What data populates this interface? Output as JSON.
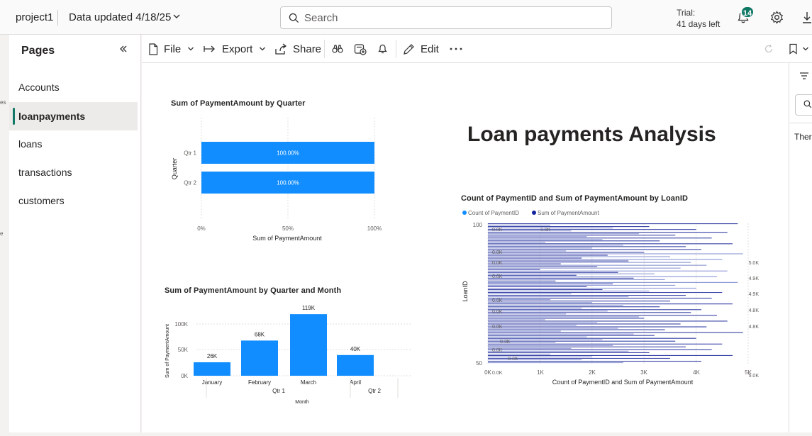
{
  "app": {
    "workspace": "project1",
    "data_updated": "Data updated 4/18/25",
    "search_placeholder": "Search",
    "trial_label": "Trial:",
    "trial_days": "41 days left",
    "notification_count": "14"
  },
  "pages_pane": {
    "title": "Pages",
    "items": [
      {
        "label": "Accounts",
        "active": false
      },
      {
        "label": "loanpayments",
        "active": true
      },
      {
        "label": "loans",
        "active": false
      },
      {
        "label": "transactions",
        "active": false
      },
      {
        "label": "customers",
        "active": false
      }
    ]
  },
  "toolbar": {
    "file": "File",
    "export": "Export",
    "share": "Share",
    "edit": "Edit"
  },
  "right_pane": {
    "text": "There"
  },
  "report": {
    "title": "Loan payments Analysis"
  },
  "chart_data": [
    {
      "type": "bar",
      "orientation": "horizontal",
      "title": "Sum of PaymentAmount by Quarter",
      "categories": [
        "Qtr 1",
        "Qtr 2"
      ],
      "values": [
        100.0,
        100.0
      ],
      "data_labels": [
        "100.00%",
        "100.00%"
      ],
      "xlabel": "Sum of PaymentAmount",
      "ylabel": "Quarter",
      "xticks": [
        "0%",
        "50%",
        "100%"
      ],
      "xlim": [
        0,
        100
      ],
      "color": "#118DFF"
    },
    {
      "type": "bar",
      "title": "Sum of PaymentAmount by Quarter and Month",
      "categories": [
        "January",
        "February",
        "March",
        "April"
      ],
      "category_groups": [
        "",
        "Qtr 1",
        "",
        "Qtr 2"
      ],
      "values": [
        26000,
        68000,
        119000,
        40000
      ],
      "data_labels": [
        "26K",
        "68K",
        "119K",
        "40K"
      ],
      "xlabel": "Month",
      "ylabel": "Sum of PaymentAmount",
      "yticks": [
        "0K",
        "50K",
        "100K"
      ],
      "ylim": [
        0,
        125000
      ],
      "color": "#118DFF"
    },
    {
      "type": "bar",
      "orientation": "horizontal",
      "title": "Count of PaymentID and Sum of PaymentAmount by LoanID",
      "legend": [
        "Count of PaymentID",
        "Sum of PaymentAmount"
      ],
      "legend_colors": [
        "#118DFF",
        "#12239E"
      ],
      "xlabel": "Count of PaymentID and Sum of PaymentAmount",
      "ylabel": "LoanID",
      "xticks": [
        "0K",
        "1K",
        "2K",
        "3K",
        "4K",
        "5K"
      ],
      "yticks": [
        "0",
        "50",
        "100"
      ],
      "xlim": [
        0,
        5000
      ],
      "ylim": [
        0,
        100
      ],
      "series": [
        {
          "name": "Sum of PaymentAmount",
          "values": [
            4800,
            1200,
            3100,
            2400,
            4000,
            1600,
            4600,
            2900,
            3600,
            1900,
            4300,
            2200,
            3300,
            1100,
            4700,
            2600,
            3800,
            2000,
            4100,
            1500,
            3000,
            4900,
            2300,
            3500,
            1800,
            4500,
            2700,
            3900,
            1400,
            4200,
            2100,
            3700,
            1000,
            4600,
            2500,
            3200,
            1700,
            4400,
            2800,
            3400,
            1300,
            4800,
            2400,
            3600,
            1900,
            4000,
            2200,
            3100,
            4500,
            1600,
            3800,
            2700,
            4300,
            1200,
            3500,
            2000,
            4700,
            2600,
            3300,
            1800,
            4100,
            2300,
            3900,
            1500,
            4400,
            2900,
            3000,
            1100,
            4600,
            2100,
            3700,
            1700,
            4200,
            2500,
            3400,
            1400,
            4900,
            2800,
            3200,
            1900,
            4000,
            2200,
            3600,
            1300,
            4500,
            2400,
            3800,
            1600,
            4300,
            2700,
            3100,
            1200,
            4700,
            2000,
            3500,
            1800,
            4100,
            2600
          ]
        }
      ],
      "data_labels": [
        "0.0K",
        "1.0K",
        "0.0K",
        "0.0K",
        "0.0K",
        "0.0K",
        "0.0K",
        "0.0K",
        "0.3K",
        "0.0K",
        "0.3K",
        "0.0K",
        "5.0K",
        "4.9K",
        "4.9K",
        "4.8K",
        "4.8K",
        "5.0K"
      ]
    }
  ]
}
